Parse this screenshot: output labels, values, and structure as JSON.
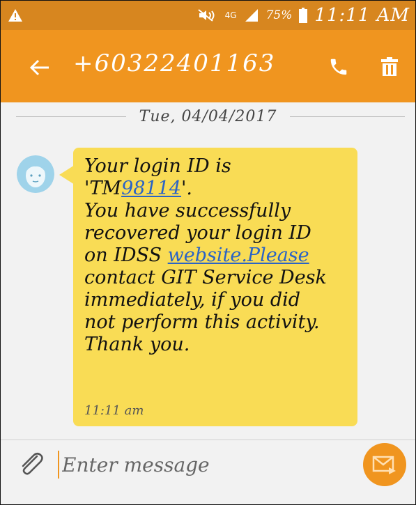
{
  "status_bar": {
    "network": "4G",
    "battery_percent": "75%",
    "time": "11:11 AM"
  },
  "app_bar": {
    "contact": "+60322401163"
  },
  "conversation": {
    "date": "Tue, 04/04/2017",
    "message": {
      "lines": [
        [
          "Your login ID is"
        ],
        [
          "'TM",
          "98114",
          "'."
        ],
        [
          "You have successfully"
        ],
        [
          "recovered your login ID"
        ],
        [
          "on IDSS ",
          "website.Please"
        ],
        [
          "contact GIT Service Desk"
        ],
        [
          "immediately, if you did"
        ],
        [
          "not perform this activity."
        ],
        [
          "Thank you."
        ]
      ],
      "time": "11:11 am"
    }
  },
  "composer": {
    "placeholder": "Enter message"
  },
  "colors": {
    "status_bar": "#d7861f",
    "app_bar": "#f0951f",
    "bubble": "#f9dc55",
    "link": "#2a63c6"
  },
  "icons": {
    "status": [
      "warning-icon",
      "mute-icon",
      "signal-icon",
      "battery-icon"
    ],
    "app_bar": [
      "back-arrow-icon",
      "phone-icon",
      "trash-icon"
    ],
    "composer": [
      "paperclip-icon",
      "send-icon"
    ]
  }
}
